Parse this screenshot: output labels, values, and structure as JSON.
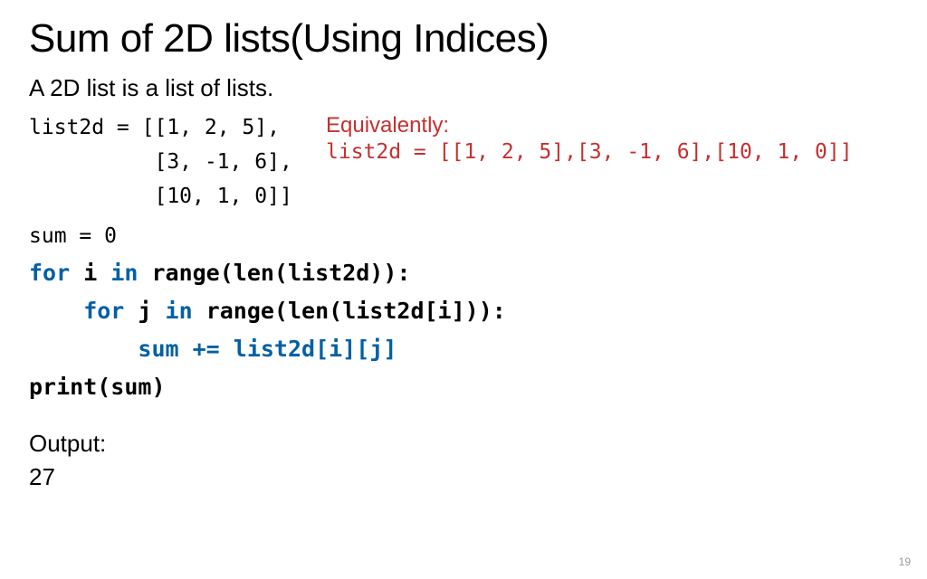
{
  "title": "Sum of 2D lists(Using Indices)",
  "subtitle": "A 2D list is a list of lists.",
  "code": {
    "line1": "list2d = [[1, 2, 5],",
    "line2": "          [3, -1, 6],",
    "line3": "          [10, 1, 0]]",
    "line4": "sum = 0",
    "line5a": "for",
    "line5b": " i ",
    "line5c": "in",
    "line5d": " range(len(list2d)):",
    "line6a": "    for",
    "line6b": " j ",
    "line6c": "in",
    "line6d": " range(len(list2d[i])):",
    "line7a": "        sum += list2d[i][j]",
    "line8": "print(sum)"
  },
  "equiv": {
    "label": "Equivalently:",
    "code": "list2d = [[1, 2, 5],[3, -1, 6],[10, 1, 0]]"
  },
  "output": {
    "label": "Output:",
    "value": "27"
  },
  "page_number": "19"
}
